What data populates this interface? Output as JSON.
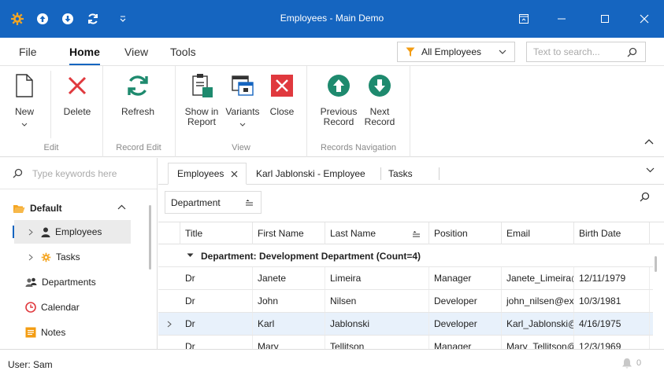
{
  "window": {
    "title": "Employees - Main Demo"
  },
  "ribbon_tabs": [
    "File",
    "Home",
    "View",
    "Tools"
  ],
  "filter": {
    "value": "All Employees"
  },
  "search": {
    "placeholder": "Text to search..."
  },
  "ribbon": {
    "new": "New",
    "delete": "Delete",
    "edit_group": "Edit",
    "refresh": "Refresh",
    "record_edit_group": "Record Edit",
    "show_in_report_1": "Show in",
    "show_in_report_2": "Report",
    "variants": "Variants",
    "close": "Close",
    "view_group": "View",
    "prev_1": "Previous",
    "prev_2": "Record",
    "next_1": "Next",
    "next_2": "Record",
    "nav_group": "Records Navigation"
  },
  "nav": {
    "search_placeholder": "Type keywords here",
    "group": "Default",
    "items": [
      "Employees",
      "Tasks",
      "Departments",
      "Calendar",
      "Notes"
    ]
  },
  "doc_tabs": [
    "Employees",
    "Karl Jablonski - Employee",
    "Tasks"
  ],
  "grid": {
    "group_by": "Department",
    "columns": [
      "Title",
      "First Name",
      "Last Name",
      "Position",
      "Email",
      "Birth Date"
    ],
    "group_row": "Department: Development Department (Count=4)",
    "rows": [
      [
        "Dr",
        "Janete",
        "Limeira",
        "Manager",
        "Janete_Limeira@example.com",
        "12/11/1979"
      ],
      [
        "Dr",
        "John",
        "Nilsen",
        "Developer",
        "john_nilsen@example.com",
        "10/3/1981"
      ],
      [
        "Dr",
        "Karl",
        "Jablonski",
        "Developer",
        "Karl_Jablonski@example.com",
        "4/16/1975"
      ],
      [
        "Dr",
        "Mary",
        "Tellitson",
        "Manager",
        "Mary_Tellitson@example.com",
        "12/3/1969"
      ]
    ]
  },
  "status": {
    "user": "User: Sam",
    "notifications": "0"
  },
  "colors": {
    "accent": "#1565c0",
    "delete_red": "#e0393e",
    "refresh_green": "#1e8a6e",
    "nav_green": "#1e8a6e",
    "selected_row": "#e8f1fb"
  }
}
